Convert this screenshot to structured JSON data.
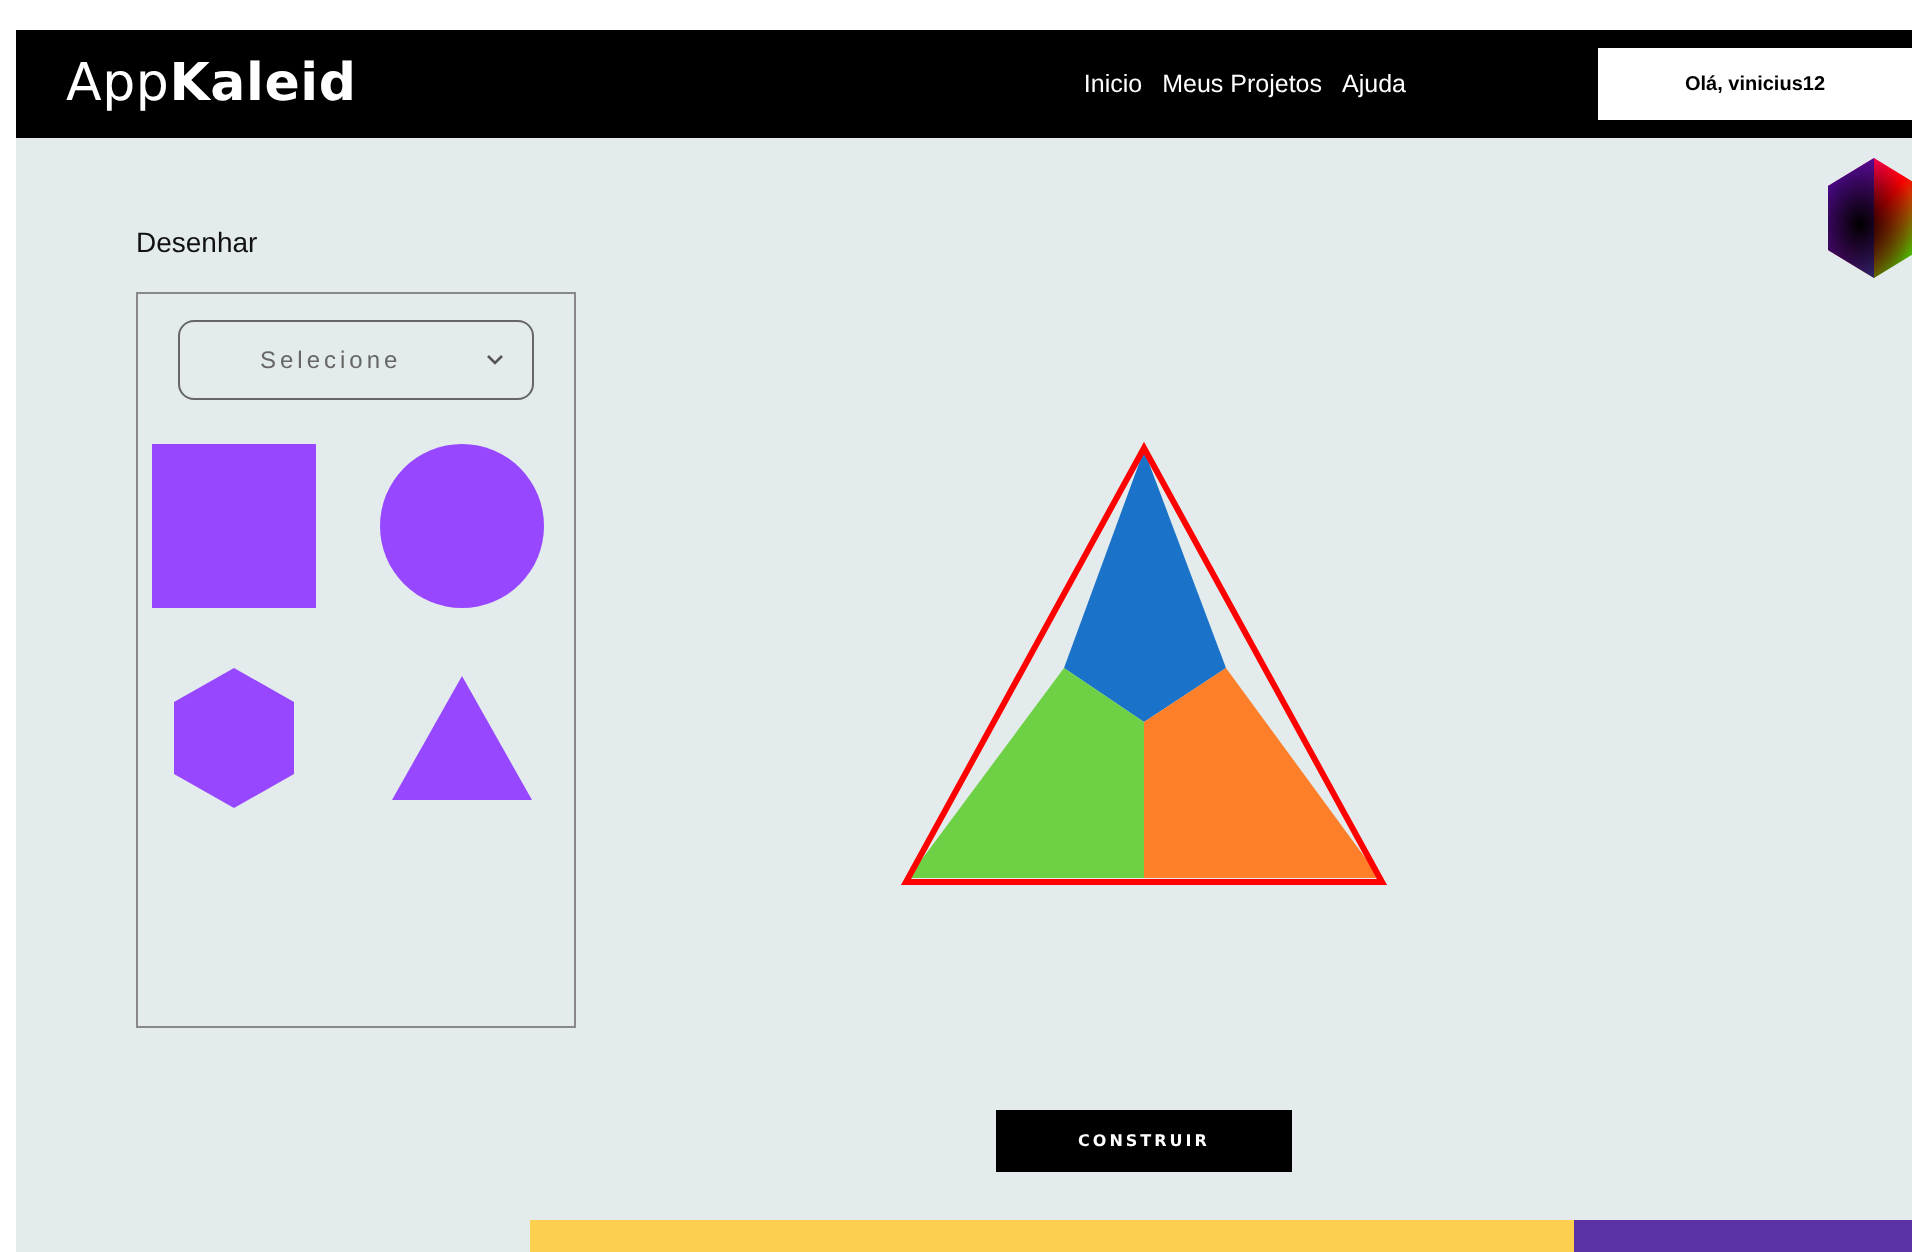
{
  "header": {
    "logo": "App**Kaleid**",
    "nav": [
      "Inicio",
      "Meus Projetos",
      "Ajuda"
    ],
    "user": "Olá, vinicius12"
  },
  "sidebar": {
    "title": "Desenhar",
    "select": {
      "placeholder": "Selecione"
    },
    "shapes": [
      {
        "kind": "square"
      },
      {
        "kind": "circle"
      },
      {
        "kind": "hexagon"
      },
      {
        "kind": "triangle"
      }
    ]
  },
  "build_button": "CONSTRUIR"
}
